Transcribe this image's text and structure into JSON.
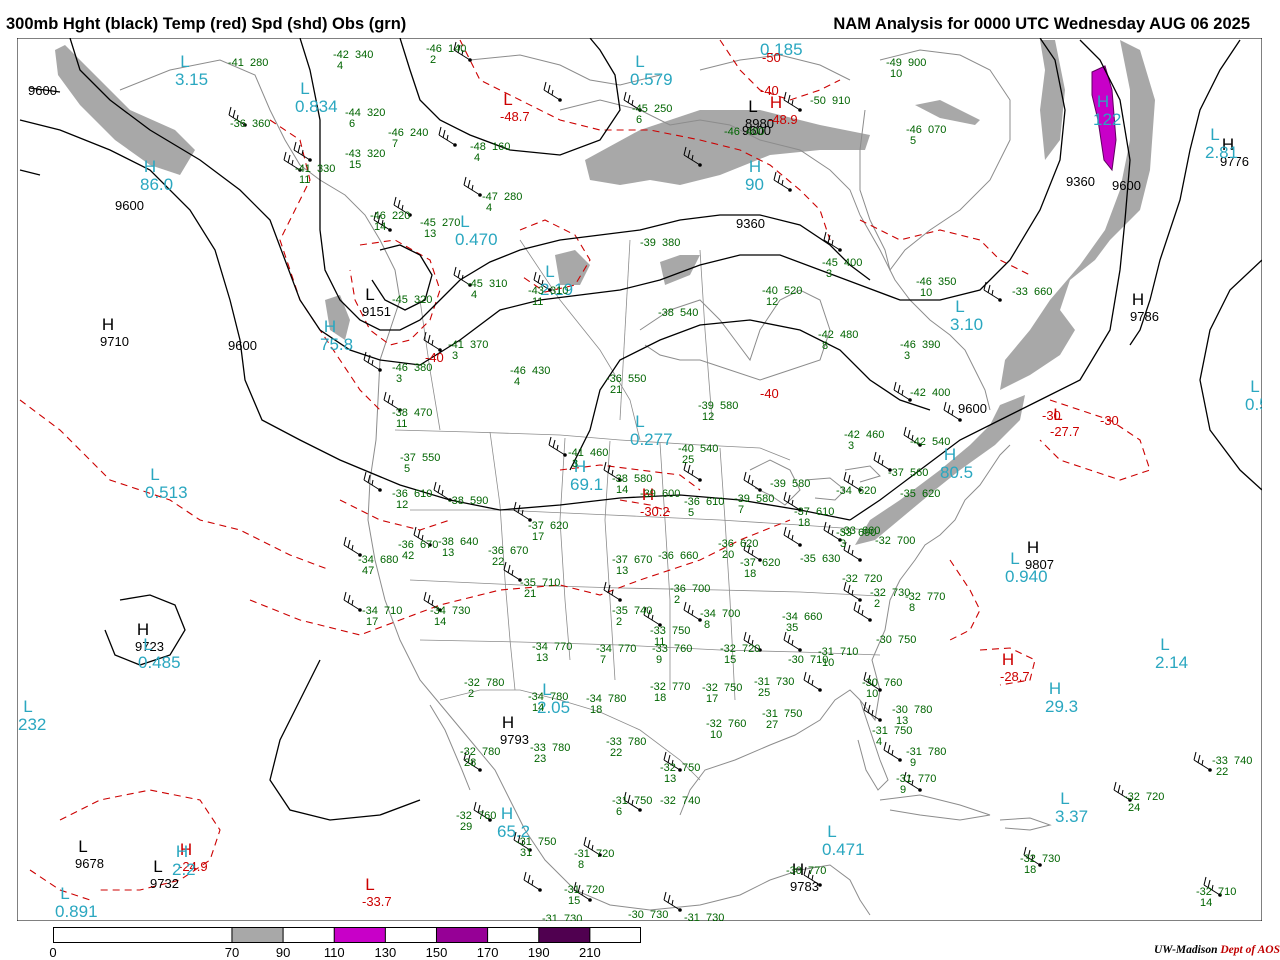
{
  "header": {
    "left_title": "300mb Hght (black) Temp (red) Spd (shd) Obs (grn)",
    "right_title": "NAM Analysis for 0000 UTC Wednesday  AUG 06 2025"
  },
  "colors": {
    "height": "#000000",
    "temperature": "#cc0000",
    "observation": "#006400",
    "wind_label": "#2aa7c0",
    "geography": "#808080",
    "speed_70_90": "#a8a8a8",
    "speed_110_130": "#c800c8",
    "speed_150_170": "#960096",
    "speed_190_210": "#500050"
  },
  "colorbar": {
    "ticks": [
      "0",
      "70",
      "90",
      "110",
      "130",
      "150",
      "170",
      "190",
      "210"
    ],
    "filled_bins": [
      {
        "from": 70,
        "to": 90,
        "color": "#a8a8a8"
      },
      {
        "from": 110,
        "to": 130,
        "color": "#c800c8"
      },
      {
        "from": 150,
        "to": 170,
        "color": "#960096"
      },
      {
        "from": 190,
        "to": 210,
        "color": "#500050"
      }
    ],
    "min": 0,
    "max": 230
  },
  "credit": {
    "org": "UW-Madison",
    "dept": "Dept of AOS"
  },
  "height_contour_labels": [
    {
      "text": "9600"
    },
    {
      "text": "9600"
    },
    {
      "text": "9600"
    },
    {
      "text": "9600"
    },
    {
      "text": "9360"
    },
    {
      "text": "9360"
    },
    {
      "text": "9600"
    },
    {
      "text": "9600"
    }
  ],
  "pressure_centers": [
    {
      "symbol": "H",
      "value": "9710",
      "kind": "height"
    },
    {
      "symbol": "L",
      "value": "9151",
      "kind": "height"
    },
    {
      "symbol": "H",
      "value": "9723",
      "kind": "height"
    },
    {
      "symbol": "H",
      "value": "9793",
      "kind": "height"
    },
    {
      "symbol": "H",
      "value": "9807",
      "kind": "height"
    },
    {
      "symbol": "H",
      "value": "9776",
      "kind": "height"
    },
    {
      "symbol": "H",
      "value": "9786",
      "kind": "height"
    },
    {
      "symbol": "L",
      "value": "9678",
      "kind": "height"
    },
    {
      "symbol": "L",
      "value": "9732",
      "kind": "height"
    },
    {
      "symbol": "H",
      "value": "9783",
      "kind": "height"
    },
    {
      "symbol": "L",
      "value": "8980",
      "kind": "height"
    },
    {
      "symbol": "L",
      "value": "-48.7",
      "kind": "temp"
    },
    {
      "symbol": "H",
      "value": "-48.9",
      "kind": "temp"
    },
    {
      "symbol": "H",
      "value": "-28.7",
      "kind": "temp"
    },
    {
      "symbol": "H",
      "value": "-24.9",
      "kind": "temp"
    },
    {
      "symbol": "L",
      "value": "-33.7",
      "kind": "temp"
    },
    {
      "symbol": "H",
      "value": "-30.2",
      "kind": "temp"
    },
    {
      "symbol": "L",
      "value": "-27.7",
      "kind": "temp"
    }
  ],
  "speed_centers": [
    {
      "symbol": "L",
      "value": "3.15"
    },
    {
      "symbol": "L",
      "value": "0.834"
    },
    {
      "symbol": "H",
      "value": "86.0"
    },
    {
      "symbol": "L",
      "value": "0.470"
    },
    {
      "symbol": "H",
      "value": "75.8"
    },
    {
      "symbol": "L",
      "value": "0.513"
    },
    {
      "symbol": "L",
      "value": "0.277"
    },
    {
      "symbol": "H",
      "value": "69.1"
    },
    {
      "symbol": "L",
      "value": "0.485"
    },
    {
      "symbol": "L",
      "value": "232"
    },
    {
      "symbol": "L",
      "value": "2.05"
    },
    {
      "symbol": "H",
      "value": "65.2"
    },
    {
      "symbol": "L",
      "value": "0.471"
    },
    {
      "symbol": "L",
      "value": "0.891"
    },
    {
      "symbol": "H",
      "value": "2.2"
    },
    {
      "symbol": "L",
      "value": "0.940"
    },
    {
      "symbol": "L",
      "value": "2.14"
    },
    {
      "symbol": "H",
      "value": "29.3"
    },
    {
      "symbol": "L",
      "value": "3.37"
    },
    {
      "symbol": "H",
      "value": "80.5"
    },
    {
      "symbol": "L",
      "value": "3.10"
    },
    {
      "symbol": "L",
      "value": "2.81"
    },
    {
      "symbol": "H",
      "value": "122"
    },
    {
      "symbol": "H",
      "value": "90"
    },
    {
      "symbol": "L",
      "value": "0.185"
    },
    {
      "symbol": "L",
      "value": "0.579"
    },
    {
      "symbol": "L",
      "value": "2.19"
    },
    {
      "symbol": "L",
      "value": "0.5"
    }
  ],
  "temp_contour_labels": [
    "-50",
    "-40",
    "-40",
    "-40",
    "-30",
    "-30"
  ],
  "observations": [
    {
      "t": "-41",
      "h": "280",
      "d": ""
    },
    {
      "t": "-42",
      "h": "340",
      "d": "4"
    },
    {
      "t": "-46",
      "h": "140",
      "d": "2"
    },
    {
      "t": "-44",
      "h": "320",
      "d": "6"
    },
    {
      "t": "-36",
      "h": "360",
      "d": ""
    },
    {
      "t": "-46",
      "h": "240",
      "d": "7"
    },
    {
      "t": "-43",
      "h": "320",
      "d": "15"
    },
    {
      "t": "-41",
      "h": "330",
      "d": "11"
    },
    {
      "t": "-48",
      "h": "160",
      "d": "4"
    },
    {
      "t": "-47",
      "h": "280",
      "d": "4"
    },
    {
      "t": "-46",
      "h": "220",
      "d": "14"
    },
    {
      "t": "-45",
      "h": "270",
      "d": "13"
    },
    {
      "t": "-45",
      "h": "320",
      "d": ""
    },
    {
      "t": "-45",
      "h": "310",
      "d": "4"
    },
    {
      "t": "-43",
      "h": "310",
      "d": "11"
    },
    {
      "t": "-41",
      "h": "370",
      "d": "3"
    },
    {
      "t": "-46",
      "h": "380",
      "d": "3"
    },
    {
      "t": "-46",
      "h": "430",
      "d": "4"
    },
    {
      "t": "-38",
      "h": "470",
      "d": "11"
    },
    {
      "t": "-37",
      "h": "550",
      "d": "5"
    },
    {
      "t": "-36",
      "h": "610",
      "d": "12"
    },
    {
      "t": "-38",
      "h": "590",
      "d": ""
    },
    {
      "t": "-36",
      "h": "670",
      "d": "42"
    },
    {
      "t": "-38",
      "h": "640",
      "d": "13"
    },
    {
      "t": "-36",
      "h": "670",
      "d": "22"
    },
    {
      "t": "-37",
      "h": "620",
      "d": "17"
    },
    {
      "t": "-34",
      "h": "680",
      "d": "47"
    },
    {
      "t": "-34",
      "h": "710",
      "d": "17"
    },
    {
      "t": "-34",
      "h": "730",
      "d": "14"
    },
    {
      "t": "-35",
      "h": "710",
      "d": "21"
    },
    {
      "t": "-39",
      "h": "380",
      "d": ""
    },
    {
      "t": "-38",
      "h": "540",
      "d": ""
    },
    {
      "t": "-36",
      "h": "550",
      "d": "21"
    },
    {
      "t": "-39",
      "h": "580",
      "d": "12"
    },
    {
      "t": "-40",
      "h": "520",
      "d": "12"
    },
    {
      "t": "-42",
      "h": "480",
      "d": "8"
    },
    {
      "t": "-41",
      "h": "460",
      "d": "3"
    },
    {
      "t": "-40",
      "h": "540",
      "d": "25"
    },
    {
      "t": "-38",
      "h": "580",
      "d": "14"
    },
    {
      "t": "-39",
      "h": "600",
      "d": ""
    },
    {
      "t": "-36",
      "h": "610",
      "d": "5"
    },
    {
      "t": "-39",
      "h": "580",
      "d": "7"
    },
    {
      "t": "-39",
      "h": "580",
      "d": ""
    },
    {
      "t": "-37",
      "h": "610",
      "d": "18"
    },
    {
      "t": "-36",
      "h": "620",
      "d": "20"
    },
    {
      "t": "-37",
      "h": "620",
      "d": "18"
    },
    {
      "t": "-37",
      "h": "670",
      "d": "13"
    },
    {
      "t": "-36",
      "h": "660",
      "d": ""
    },
    {
      "t": "-36",
      "h": "700",
      "d": "2"
    },
    {
      "t": "-35",
      "h": "740",
      "d": "2"
    },
    {
      "t": "-34",
      "h": "700",
      "d": "8"
    },
    {
      "t": "-33",
      "h": "750",
      "d": "11"
    },
    {
      "t": "-34",
      "h": "770",
      "d": "13"
    },
    {
      "t": "-34",
      "h": "770",
      "d": "7"
    },
    {
      "t": "-33",
      "h": "760",
      "d": "9"
    },
    {
      "t": "-32",
      "h": "720",
      "d": "15"
    },
    {
      "t": "-34",
      "h": "660",
      "d": "35"
    },
    {
      "t": "-35",
      "h": "630",
      "d": ""
    },
    {
      "t": "-33",
      "h": "660",
      "d": ""
    },
    {
      "t": "-32",
      "h": "700",
      "d": ""
    },
    {
      "t": "-32",
      "h": "720",
      "d": ""
    },
    {
      "t": "-32",
      "h": "730",
      "d": "2"
    },
    {
      "t": "-32",
      "h": "770",
      "d": "8"
    },
    {
      "t": "-30",
      "h": "750",
      "d": ""
    },
    {
      "t": "-31",
      "h": "710",
      "d": "10"
    },
    {
      "t": "-30",
      "h": "710",
      "d": ""
    },
    {
      "t": "-31",
      "h": "730",
      "d": "25"
    },
    {
      "t": "-32",
      "h": "780",
      "d": "2"
    },
    {
      "t": "-34",
      "h": "780",
      "d": "14"
    },
    {
      "t": "-34",
      "h": "780",
      "d": "18"
    },
    {
      "t": "-32",
      "h": "770",
      "d": "18"
    },
    {
      "t": "-32",
      "h": "750",
      "d": "17"
    },
    {
      "t": "-32",
      "h": "760",
      "d": "10"
    },
    {
      "t": "-31",
      "h": "750",
      "d": "27"
    },
    {
      "t": "-30",
      "h": "760",
      "d": "10"
    },
    {
      "t": "-30",
      "h": "780",
      "d": "13"
    },
    {
      "t": "-31",
      "h": "750",
      "d": "4"
    },
    {
      "t": "-31",
      "h": "780",
      "d": "9"
    },
    {
      "t": "-31",
      "h": "770",
      "d": "9"
    },
    {
      "t": "-32",
      "h": "780",
      "d": "28"
    },
    {
      "t": "-33",
      "h": "780",
      "d": "23"
    },
    {
      "t": "-33",
      "h": "780",
      "d": "22"
    },
    {
      "t": "-32",
      "h": "750",
      "d": "13"
    },
    {
      "t": "-31",
      "h": "750",
      "d": "6"
    },
    {
      "t": "-32",
      "h": "740",
      "d": ""
    },
    {
      "t": "-32",
      "h": "760",
      "d": "29"
    },
    {
      "t": "-31",
      "h": "750",
      "d": "31"
    },
    {
      "t": "-31",
      "h": "720",
      "d": "8"
    },
    {
      "t": "-31",
      "h": "720",
      "d": "15"
    },
    {
      "t": "-31",
      "h": "730",
      "d": ""
    },
    {
      "t": "-30",
      "h": "730",
      "d": ""
    },
    {
      "t": "-31",
      "h": "730",
      "d": ""
    },
    {
      "t": "-30",
      "h": "770",
      "d": ""
    },
    {
      "t": "-33",
      "h": "740",
      "d": "22"
    },
    {
      "t": "-32",
      "h": "720",
      "d": "24"
    },
    {
      "t": "-32",
      "h": "730",
      "d": "18"
    },
    {
      "t": "-32",
      "h": "710",
      "d": "14"
    },
    {
      "t": "-49",
      "h": "900",
      "d": "10"
    },
    {
      "t": "-46",
      "h": "070",
      "d": "5"
    },
    {
      "t": "-50",
      "h": "910",
      "d": ""
    },
    {
      "t": "-45",
      "h": "400",
      "d": "3"
    },
    {
      "t": "-46",
      "h": "350",
      "d": "10"
    },
    {
      "t": "-46",
      "h": "390",
      "d": "3"
    },
    {
      "t": "-42",
      "h": "400",
      "d": ""
    },
    {
      "t": "-42",
      "h": "460",
      "d": "3"
    },
    {
      "t": "-42",
      "h": "540",
      "d": ""
    },
    {
      "t": "-37",
      "h": "560",
      "d": ""
    },
    {
      "t": "-34",
      "h": "620",
      "d": ""
    },
    {
      "t": "-35",
      "h": "620",
      "d": ""
    },
    {
      "t": "-33",
      "h": "690",
      "d": "3"
    },
    {
      "t": "-33",
      "h": "660",
      "d": ""
    },
    {
      "t": "-46",
      "h": "400",
      "d": ""
    },
    {
      "t": "-45",
      "h": "250",
      "d": "6"
    },
    {
      "t": "-48",
      "h": "970",
      "d": ""
    },
    {
      "t": "-46",
      "h": "640",
      "d": "21"
    }
  ]
}
